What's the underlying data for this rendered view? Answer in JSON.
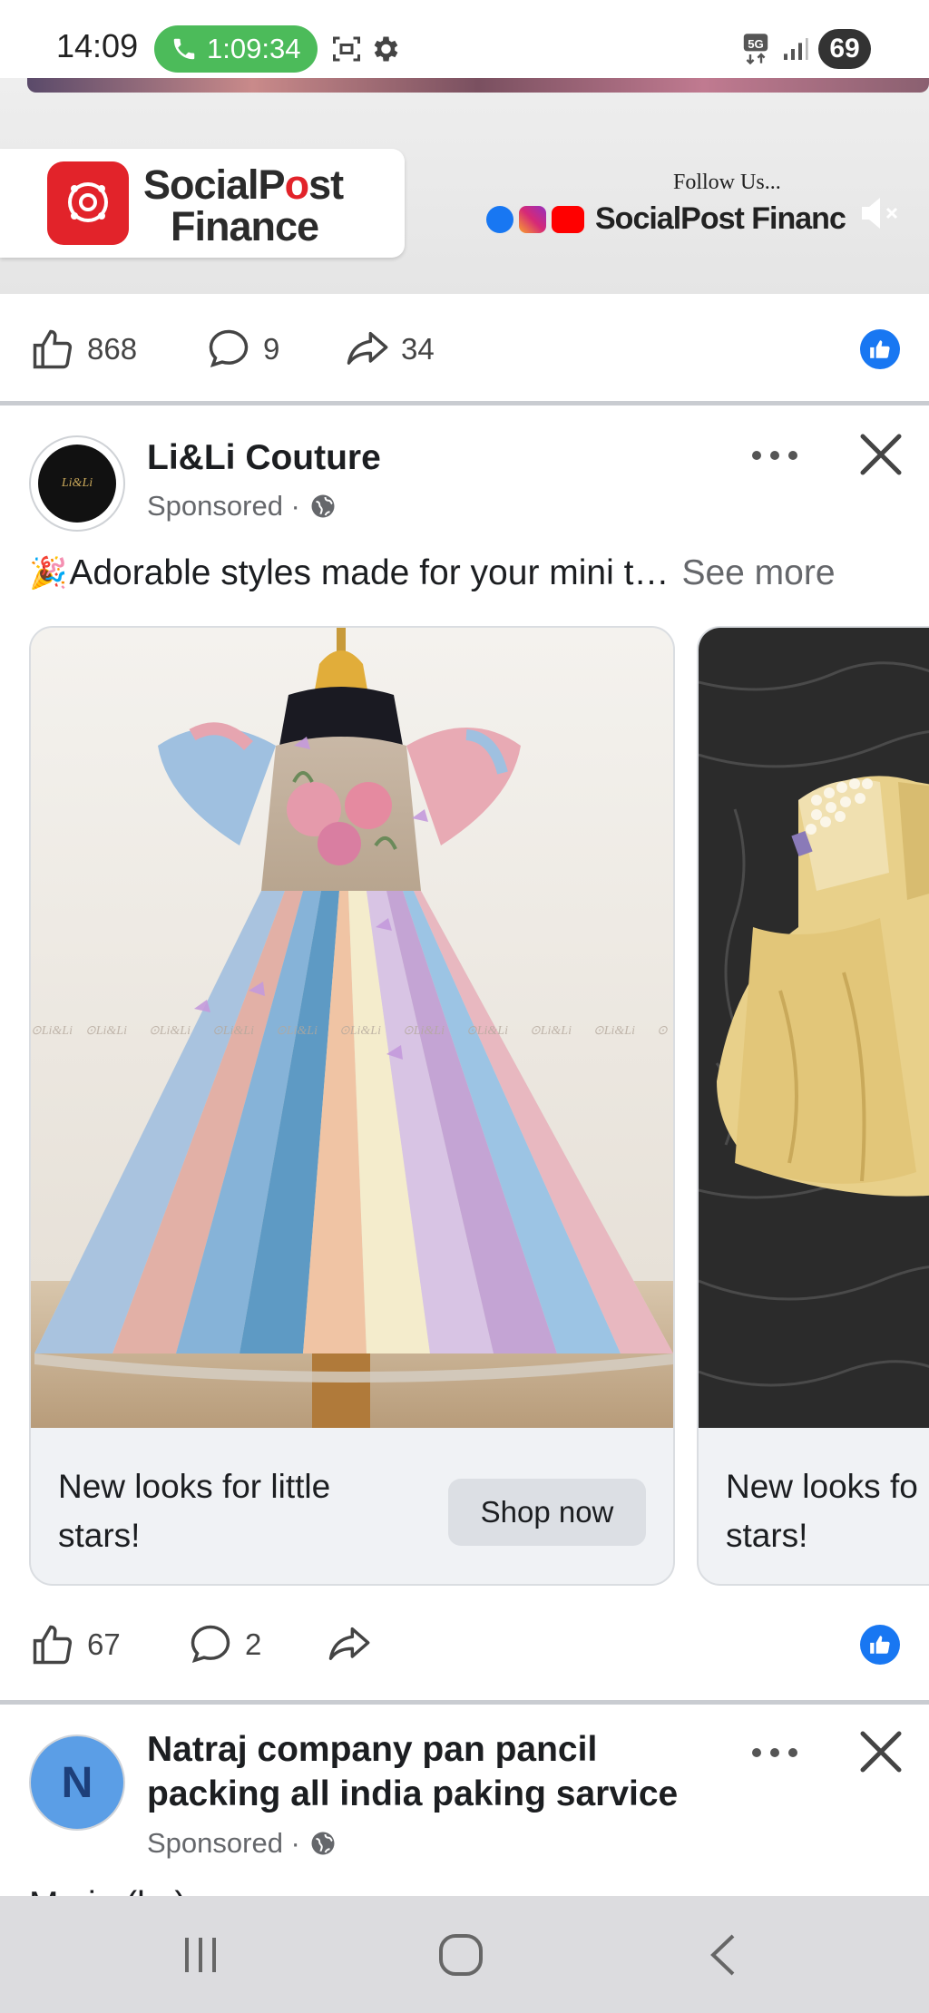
{
  "status_bar": {
    "time": "14:09",
    "call_timer": "1:09:34",
    "network": "5G",
    "battery": "69"
  },
  "previous_post": {
    "banner": {
      "brand_line1_a": "SocialP",
      "brand_line1_o": "o",
      "brand_line1_b": "st",
      "brand_line2": "Finance",
      "follow_label": "Follow Us...",
      "follow_name": "SocialPost Financ"
    },
    "stats": {
      "likes": "868",
      "comments": "9",
      "shares": "34"
    }
  },
  "post1": {
    "page_name": "Li&Li Couture",
    "avatar_text": "Li&Li",
    "sponsored": "Sponsored ·",
    "text": "Adorable styles made for your mini t…",
    "text_emoji": "🎉",
    "see_more": "See more",
    "cards": [
      {
        "caption_line1": "New looks for little",
        "caption_line2": "stars!",
        "cta": "Shop now"
      },
      {
        "caption_line1": "New looks fo",
        "caption_line2": "stars!"
      }
    ],
    "stats": {
      "likes": "67",
      "comments": "2"
    }
  },
  "post2": {
    "avatar_letter": "N",
    "page_name_line1": "Natraj company pan pancil",
    "page_name_line2": "packing all india paking sarvice",
    "sponsored": "Sponsored ·",
    "text_partial": "M...i...(l...)..."
  },
  "colors": {
    "facebook_blue": "#1877f2",
    "call_green": "#4cbb5a",
    "brand_red": "#e2232a"
  },
  "icons": [
    "phone-icon",
    "screenshot-icon",
    "gear-icon",
    "signal-icon",
    "like-icon",
    "comment-icon",
    "share-icon",
    "like-badge-icon",
    "more-icon",
    "close-icon",
    "globe-icon",
    "mute-icon",
    "recents-icon",
    "home-icon",
    "back-icon"
  ]
}
